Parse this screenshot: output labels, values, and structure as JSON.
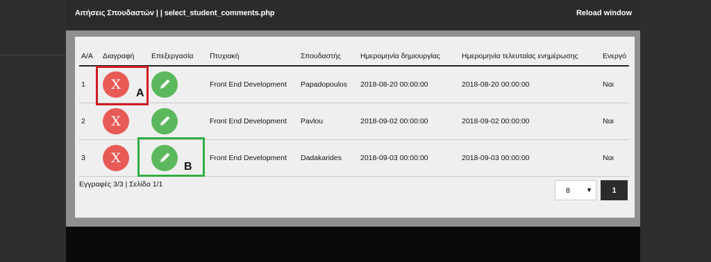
{
  "window": {
    "title": "Αιτήσεις Σπουδαστών | | select_student_comments.php",
    "reload_label": "Reload window"
  },
  "table": {
    "headers": [
      "Α/Α",
      "Διαγραφή",
      "Επεξεργασία",
      "Πτυχιακή",
      "Σπουδαστής",
      "Ημερομηνία δημιουργίας",
      "Ημερομηνία τελευταίας ενημέρωσης",
      "Ενεργό"
    ],
    "rows": [
      {
        "index": "1",
        "delete": "X",
        "thesis": "Front End Development",
        "student": "Papadopoulos",
        "created": "2018-08-20 00:00:00",
        "updated": "2018-08-20 00:00:00",
        "active": "Ναι"
      },
      {
        "index": "2",
        "delete": "X",
        "thesis": "Front End Development",
        "student": "Pavlou",
        "created": "2018-09-02 00:00:00",
        "updated": "2018-09-02 00:00:00",
        "active": "Ναι"
      },
      {
        "index": "3",
        "delete": "X",
        "thesis": "Front End Development",
        "student": "Dadakarides",
        "created": "2018-09-03 00:00:00",
        "updated": "2018-09-03 00:00:00",
        "active": "Ναι"
      }
    ]
  },
  "annotations": {
    "a": "A",
    "b": "B"
  },
  "footer": {
    "records_text": "Εγγραφές 3/3 | Σελίδα 1/1",
    "per_page": "8",
    "page_button": "1"
  },
  "colors": {
    "delete": "#e85a55",
    "edit": "#5cb85c",
    "box_a": "#d11a22",
    "box_b": "#2fae43"
  }
}
